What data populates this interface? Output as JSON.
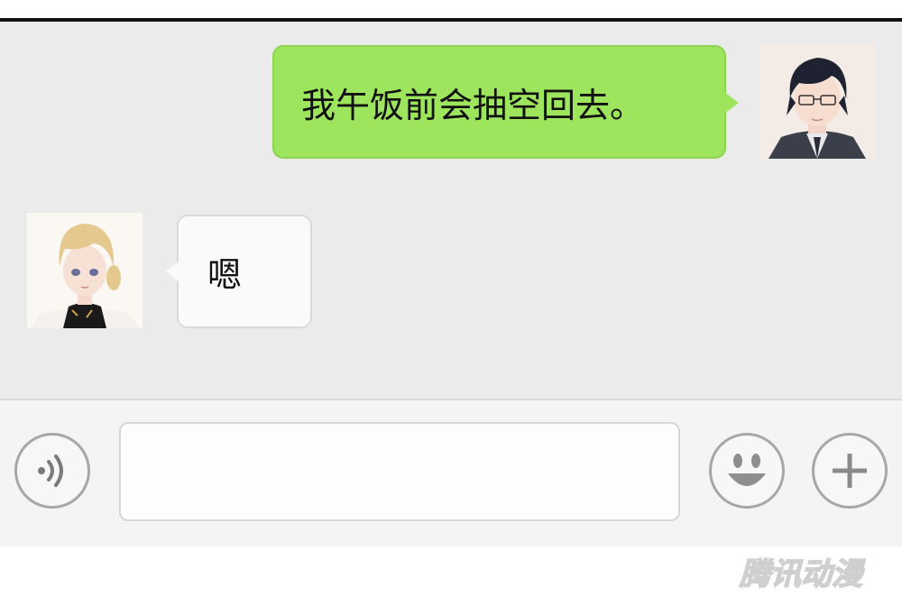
{
  "conversation": {
    "messages": [
      {
        "sender": "self",
        "text": "我午饭前会抽空回去。"
      },
      {
        "sender": "other",
        "text": "嗯"
      }
    ]
  },
  "input_bar": {
    "voice_button": {
      "icon": "voice-icon"
    },
    "message_input": {
      "value": "",
      "placeholder": ""
    },
    "emoji_button": {
      "icon": "emoji-icon"
    },
    "more_button": {
      "icon": "plus-icon"
    }
  },
  "watermark": {
    "text": "腾讯动漫"
  },
  "colors": {
    "chat_background": "#ebebeb",
    "outgoing_bubble": "#9ee55e",
    "incoming_bubble": "#fafafa",
    "icon_gray": "#a7a7a7"
  }
}
